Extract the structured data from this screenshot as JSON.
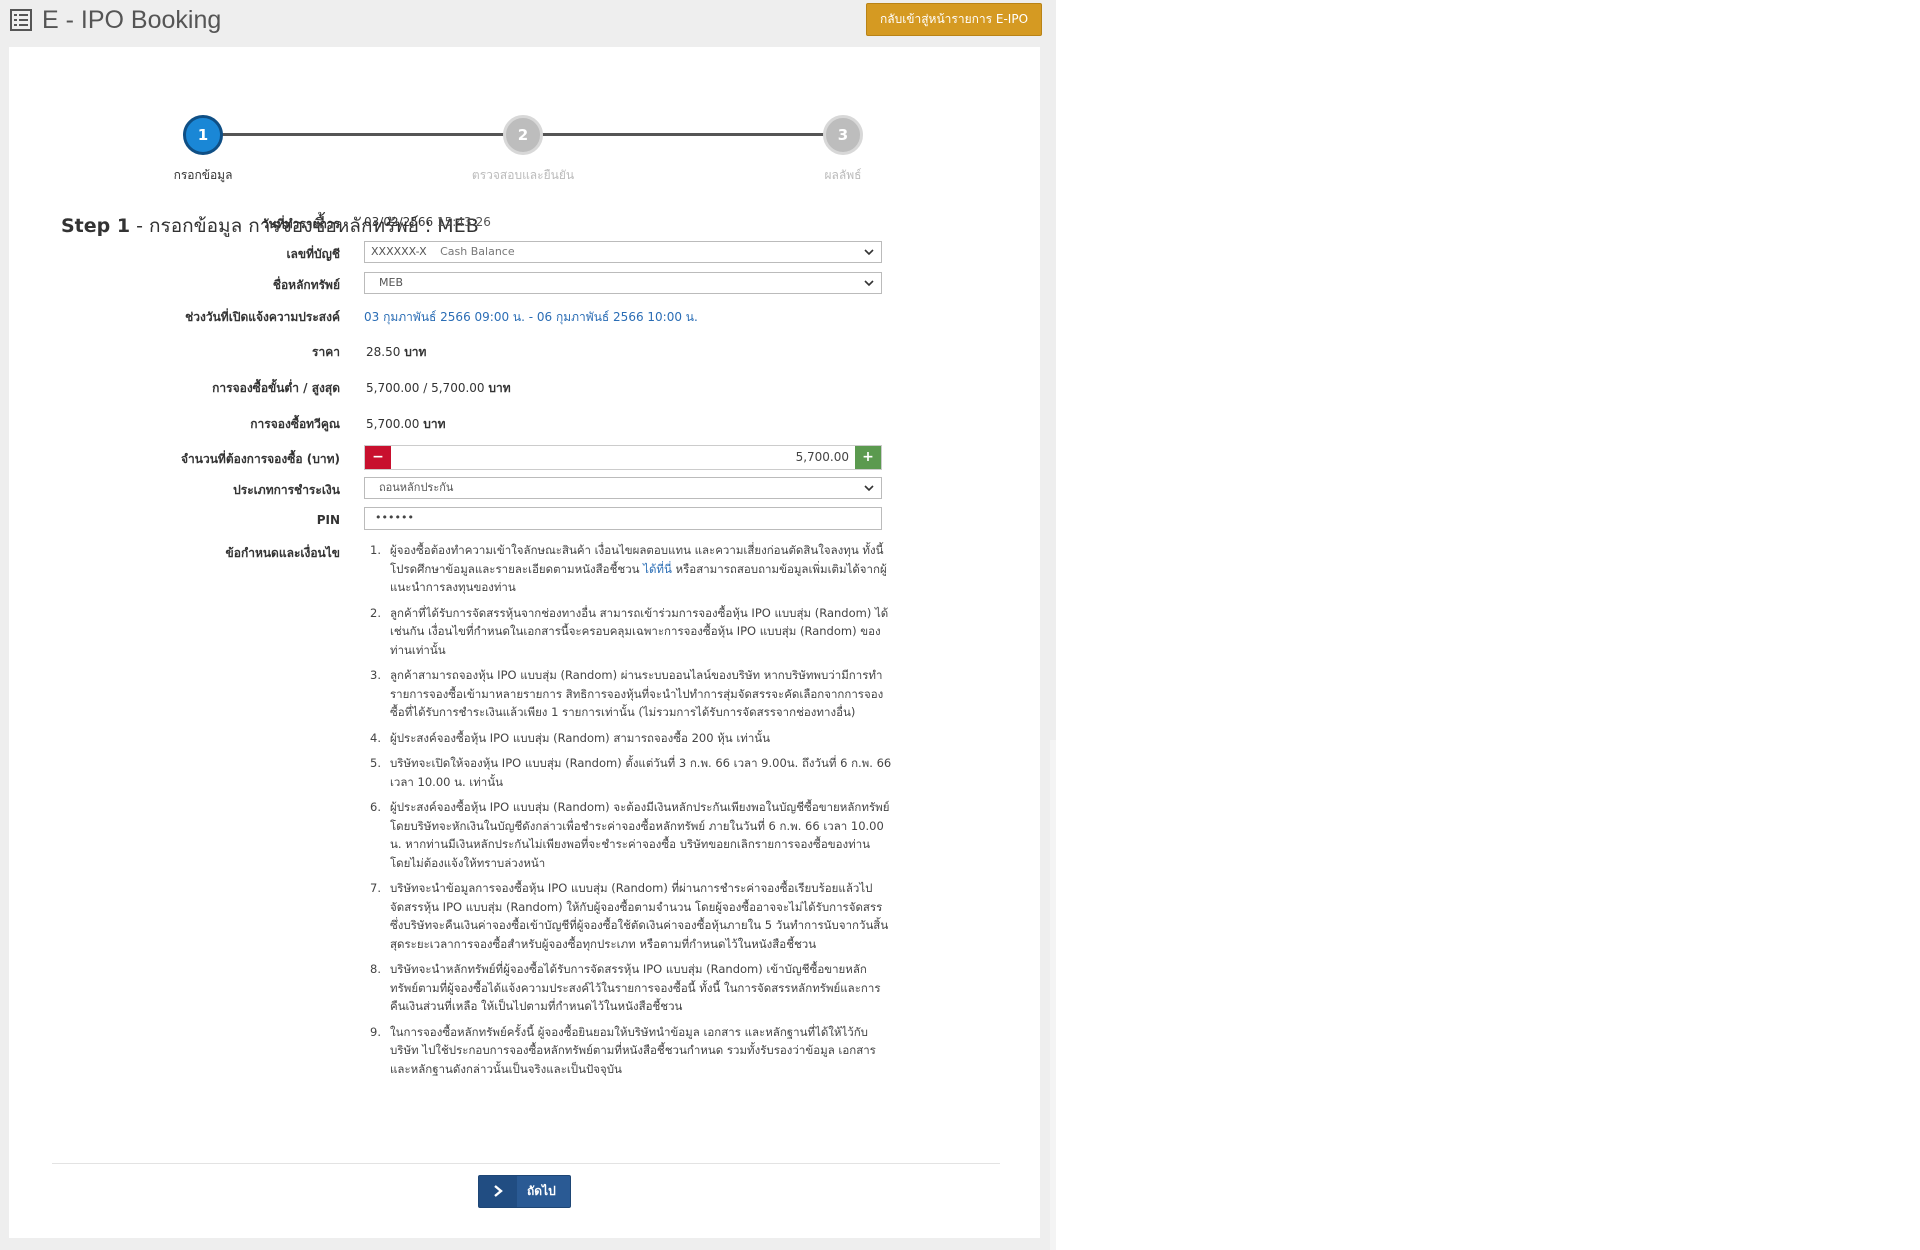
{
  "header": {
    "title": "E - IPO Booking",
    "back_button": "กลับเข้าสู่หน้ารายการ E-IPO"
  },
  "steps": [
    {
      "number": "1",
      "label": "กรอกข้อมูล"
    },
    {
      "number": "2",
      "label": "ตรวจสอบและยืนยัน"
    },
    {
      "number": "3",
      "label": "ผลลัพธ์"
    }
  ],
  "heading": {
    "step": "Step 1",
    "text": "- กรอกข้อมูล การจองซื้อหลักทรัพย์ : MEB"
  },
  "form": {
    "date": {
      "label": "วันที่ทำรายการ",
      "date": "03/02/2566",
      "time": "15:43:26"
    },
    "account": {
      "label": "เลขที่บัญชี",
      "value": "XXXXXX-X",
      "type": "Cash Balance"
    },
    "security": {
      "label": "ชื่อหลักทรัพย์",
      "value": "MEB"
    },
    "period": {
      "label": "ช่วงวันที่เปิดแจ้งความประสงค์",
      "value": "03 กุมภาพันธ์ 2566 09:00 น. - 06 กุมภาพันธ์ 2566 10:00 น."
    },
    "price": {
      "label": "ราคา",
      "value": "28.50",
      "unit": "บาท"
    },
    "min_max": {
      "label": "การจองซื้อขั้นต่ำ / สูงสุด",
      "value": "5,700.00 / 5,700.00",
      "unit": "บาท"
    },
    "multiple": {
      "label": "การจองซื้อทวีคูณ",
      "value": "5,700.00",
      "unit": "บาท"
    },
    "amount": {
      "label": "จำนวนที่ต้องการจองซื้อ (บาท)",
      "value": "5,700.00",
      "minus": "−",
      "plus": "+"
    },
    "payment": {
      "label": "ประเภทการชำระเงิน",
      "value": "ถอนหลักประกัน"
    },
    "pin": {
      "label": "PIN",
      "value": "••••••"
    },
    "terms_label": "ข้อกำหนดและเงื่อนไข"
  },
  "terms": [
    {
      "num": "1.",
      "text": "ผู้จองซื้อต้องทำความเข้าใจลักษณะสินค้า เงื่อนไขผลตอบแทน และความเสี่ยงก่อนตัดสินใจลงทุน ทั้งนี้ โปรดศึกษาข้อมูลและรายละเอียดตามหนังสือชี้ชวน",
      "link": "ได้ที่นี่",
      "text2": "หรือสามารถสอบถามข้อมูลเพิ่มเติมได้จากผู้แนะนำการลงทุนของท่าน"
    },
    {
      "num": "2.",
      "text": "ลูกค้าที่ได้รับการจัดสรรหุ้นจากช่องทางอื่น สามารถเข้าร่วมการจองซื้อหุ้น IPO แบบสุ่ม (Random) ได้เช่นกัน เงื่อนไขที่กำหนดในเอกสารนี้จะครอบคลุมเฉพาะการจองซื้อหุ้น IPO แบบสุ่ม (Random) ของท่านเท่านั้น"
    },
    {
      "num": "3.",
      "text": "ลูกค้าสามารถจองหุ้น IPO แบบสุ่ม (Random) ผ่านระบบออนไลน์ของบริษัท หากบริษัทพบว่ามีการทำรายการจองซื้อเข้ามาหลายรายการ สิทธิการจองหุ้นที่จะนำไปทำการสุ่มจัดสรรจะคัดเลือกจากการจองซื้อที่ได้รับการชำระเงินแล้วเพียง 1 รายการเท่านั้น (ไม่รวมการได้รับการจัดสรรจากช่องทางอื่น)"
    },
    {
      "num": "4.",
      "text": "ผู้ประสงค์จองซื้อหุ้น IPO แบบสุ่ม (Random) สามารถจองซื้อ 200 หุ้น เท่านั้น"
    },
    {
      "num": "5.",
      "text": "บริษัทจะเปิดให้จองหุ้น IPO แบบสุ่ม (Random) ตั้งแต่วันที่ 3 ก.พ. 66 เวลา 9.00น. ถึงวันที่ 6 ก.พ. 66 เวลา 10.00 น. เท่านั้น"
    },
    {
      "num": "6.",
      "text": "ผู้ประสงค์จองซื้อหุ้น IPO แบบสุ่ม (Random) จะต้องมีเงินหลักประกันเพียงพอในบัญชีซื้อขายหลักทรัพย์ โดยบริษัทจะหักเงินในบัญชีดังกล่าวเพื่อชำระค่าจองซื้อหลักทรัพย์ ภายในวันที่ 6 ก.พ. 66 เวลา 10.00 น. หากท่านมีเงินหลักประกันไม่เพียงพอที่จะชำระค่าจองซื้อ บริษัทขอยกเลิกรายการจองซื้อของท่าน โดยไม่ต้องแจ้งให้ทราบล่วงหน้า"
    },
    {
      "num": "7.",
      "text": "บริษัทจะนำข้อมูลการจองซื้อหุ้น IPO แบบสุ่ม (Random) ที่ผ่านการชำระค่าจองซื้อเรียบร้อยแล้วไปจัดสรรหุ้น IPO แบบสุ่ม (Random) ให้กับผู้จองซื้อตามจำนวน โดยผู้จองซื้ออาจจะไม่ได้รับการจัดสรร ซึ่งบริษัทจะคืนเงินค่าจองซื้อเข้าบัญชีที่ผู้จองซื้อใช้ตัดเงินค่าจองซื้อหุ้นภายใน 5 วันทำการนับจากวันสิ้นสุดระยะเวลาการจองซื้อสำหรับผู้จองซื้อทุกประเภท หรือตามที่กำหนดไว้ในหนังสือชี้ชวน"
    },
    {
      "num": "8.",
      "text": "บริษัทจะนำหลักทรัพย์ที่ผู้จองซื้อได้รับการจัดสรรหุ้น IPO แบบสุ่ม (Random) เข้าบัญชีซื้อขายหลักทรัพย์ตามที่ผู้จองซื้อได้แจ้งความประสงค์ไว้ในรายการจองซื้อนี้ ทั้งนี้ ในการจัดสรรหลักทรัพย์และการคืนเงินส่วนที่เหลือ ให้เป็นไปตามที่กำหนดไว้ในหนังสือชี้ชวน"
    },
    {
      "num": "9.",
      "text": "ในการจองซื้อหลักทรัพย์ครั้งนี้ ผู้จองซื้อยินยอมให้บริษัทนำข้อมูล เอกสาร และหลักฐานที่ได้ให้ไว้กับบริษัท ไปใช้ประกอบการจองซื้อหลักทรัพย์ตามที่หนังสือชี้ชวนกำหนด รวมทั้งรับรองว่าข้อมูล เอกสาร และหลักฐานดังกล่าวนั้นเป็นจริงและเป็นปัจจุบัน"
    }
  ],
  "footer": {
    "next_button": "ถัดไป"
  },
  "colors": {
    "accent": "#1a87d6",
    "back_button": "#d59a22",
    "next_button": "#2a5a94",
    "minus": "#c8102e",
    "plus": "#5b9a4f"
  }
}
